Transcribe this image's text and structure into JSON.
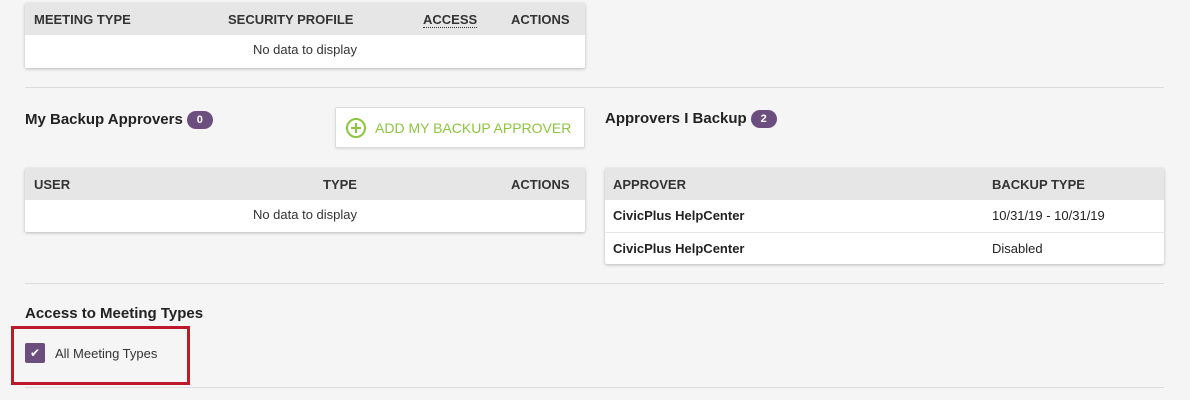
{
  "top_table": {
    "headers": {
      "meeting_type": "MEETING TYPE",
      "security_profile": "SECURITY PROFILE",
      "access": "ACCESS",
      "actions": "ACTIONS"
    },
    "empty_text": "No data to display"
  },
  "backup_approvers": {
    "title": "My Backup Approvers",
    "count": "0",
    "add_button_label": "ADD MY BACKUP APPROVER",
    "headers": {
      "user": "USER",
      "type": "TYPE",
      "actions": "ACTIONS"
    },
    "empty_text": "No data to display"
  },
  "approvers_i_backup": {
    "title": "Approvers I Backup",
    "count": "2",
    "headers": {
      "approver": "APPROVER",
      "backup_type": "BACKUP TYPE"
    },
    "rows": [
      {
        "approver": "CivicPlus HelpCenter",
        "backup_type": "10/31/19 - 10/31/19"
      },
      {
        "approver": "CivicPlus HelpCenter",
        "backup_type": "Disabled"
      }
    ]
  },
  "access_meeting_types": {
    "title": "Access to Meeting Types",
    "checkbox_label": "All Meeting Types",
    "checked": true
  },
  "colors": {
    "badge": "#6b4e7d",
    "add_button_text": "#8cc63e",
    "highlight_border": "#c0182b"
  }
}
